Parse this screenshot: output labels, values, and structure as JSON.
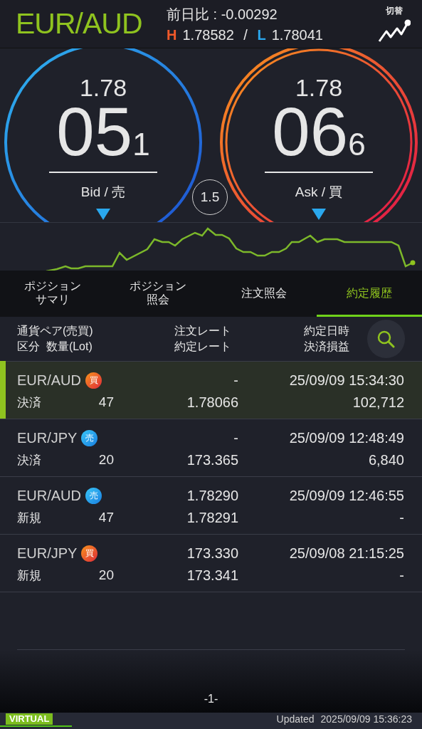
{
  "header": {
    "pair": "EUR/AUD",
    "change": "前日比 : -0.00292",
    "high_label": "H",
    "high": "1.78582",
    "separator": "/",
    "low_label": "L",
    "low": "1.78041",
    "switch_label": "切替"
  },
  "quotes": [
    {
      "kind": "bid",
      "prefix": "1.78",
      "big": "05",
      "small": "1",
      "label": "Bid / 売"
    },
    {
      "kind": "ask",
      "prefix": "1.78",
      "big": "06",
      "small": "6",
      "label": "Ask / 買"
    }
  ],
  "spread": "1.5",
  "tabs": [
    {
      "lines": [
        "ポジション",
        "サマリ"
      ],
      "selected": false
    },
    {
      "lines": [
        "ポジション",
        "照会"
      ],
      "selected": false
    },
    {
      "lines": [
        "注文照会"
      ],
      "selected": false
    },
    {
      "lines": [
        "約定履歴"
      ],
      "selected": true
    }
  ],
  "columns": [
    {
      "top": "通貨ペア(売買)",
      "bottom": "区分  数量(Lot)"
    },
    {
      "top": "注文レート",
      "bottom": "約定レート"
    },
    {
      "top": "約定日時",
      "bottom": "決済損益"
    }
  ],
  "rows": [
    {
      "pair": "EUR/AUD",
      "kind": "buy",
      "side_label": "買",
      "type": "決済",
      "lot": "47",
      "order_rate": "-",
      "exec_rate": "1.78066",
      "datetime": "25/09/09 15:34:30",
      "pnl": "102,712",
      "selected": true
    },
    {
      "pair": "EUR/JPY",
      "kind": "sell",
      "side_label": "売",
      "type": "決済",
      "lot": "20",
      "order_rate": "-",
      "exec_rate": "173.365",
      "datetime": "25/09/09 12:48:49",
      "pnl": "6,840",
      "selected": false
    },
    {
      "pair": "EUR/AUD",
      "kind": "sell",
      "side_label": "売",
      "type": "新規",
      "lot": "47",
      "order_rate": "1.78290",
      "exec_rate": "1.78291",
      "datetime": "25/09/09 12:46:55",
      "pnl": "-",
      "selected": false
    },
    {
      "pair": "EUR/JPY",
      "kind": "buy",
      "side_label": "買",
      "type": "新規",
      "lot": "20",
      "order_rate": "173.330",
      "exec_rate": "173.341",
      "datetime": "25/09/08 21:15:25",
      "pnl": "-",
      "selected": false
    }
  ],
  "pager": "-1-",
  "status_bar": {
    "badge": "VIRTUAL",
    "updated_label": "Updated",
    "updated": "2025/09/09 15:36:23",
    "level": 0.17
  }
}
